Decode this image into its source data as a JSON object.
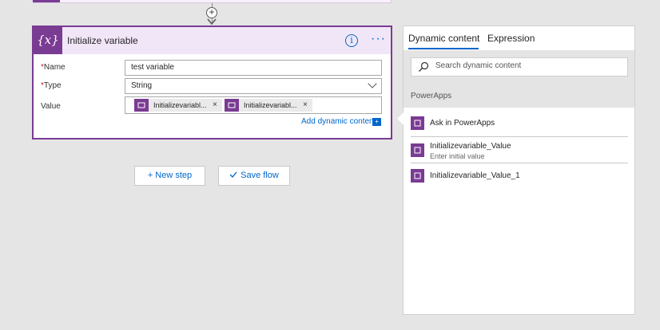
{
  "card": {
    "title": "Initialize variable",
    "fields": {
      "name_label": "Name",
      "name_value": "test variable",
      "type_label": "Type",
      "type_value": "String",
      "value_label": "Value",
      "tokens": [
        "Initializevariabl...",
        "Initializevariabl..."
      ]
    },
    "add_dynamic_label": "Add dynamic content"
  },
  "buttons": {
    "new_step": "+ New step",
    "save_flow": "Save flow"
  },
  "panel": {
    "tabs": [
      "Dynamic content",
      "Expression"
    ],
    "search_placeholder": "Search dynamic content",
    "section": "PowerApps",
    "items": [
      {
        "label": "Ask in PowerApps",
        "sub": ""
      },
      {
        "label": "Initializevariable_Value",
        "sub": "Enter initial value"
      },
      {
        "label": "Initializevariable_Value_1",
        "sub": ""
      }
    ]
  },
  "colors": {
    "accent": "#7a3b93",
    "link": "#0066cc",
    "header_bg": "#f1e6f7"
  }
}
